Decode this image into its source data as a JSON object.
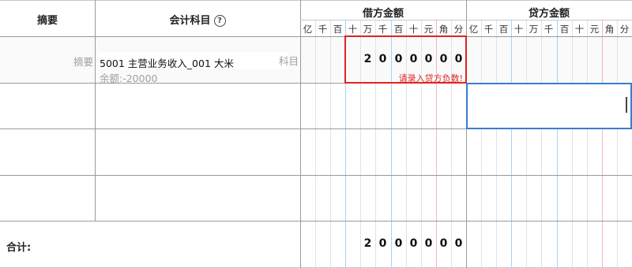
{
  "header": {
    "summary": "摘要",
    "account": "会计科目",
    "help_icon_glyph": "?",
    "debit": "借方金额",
    "credit": "贷方金额",
    "units": [
      "亿",
      "千",
      "百",
      "十",
      "万",
      "千",
      "百",
      "十",
      "元",
      "角",
      "分"
    ]
  },
  "rows": [
    {
      "summary_placeholder": "摘要",
      "account_value": "5001 主营业务收入_001 大米",
      "account_suffix": "科目",
      "balance": "余额:-20000",
      "debit_digits": [
        "2",
        "0",
        "0",
        "0",
        "0",
        "0",
        "0"
      ],
      "error_message": "请录入贷方负数!"
    }
  ],
  "total": {
    "label": "合计:",
    "debit_digits": [
      "2",
      "0",
      "0",
      "0",
      "0",
      "0",
      "0"
    ]
  },
  "colors": {
    "grid": "#c8c8c8",
    "blue_sep": "#a8d4f0",
    "red_sep": "#f2b8b8",
    "error_red": "#e02424",
    "focus_blue": "#3a7ed0"
  }
}
